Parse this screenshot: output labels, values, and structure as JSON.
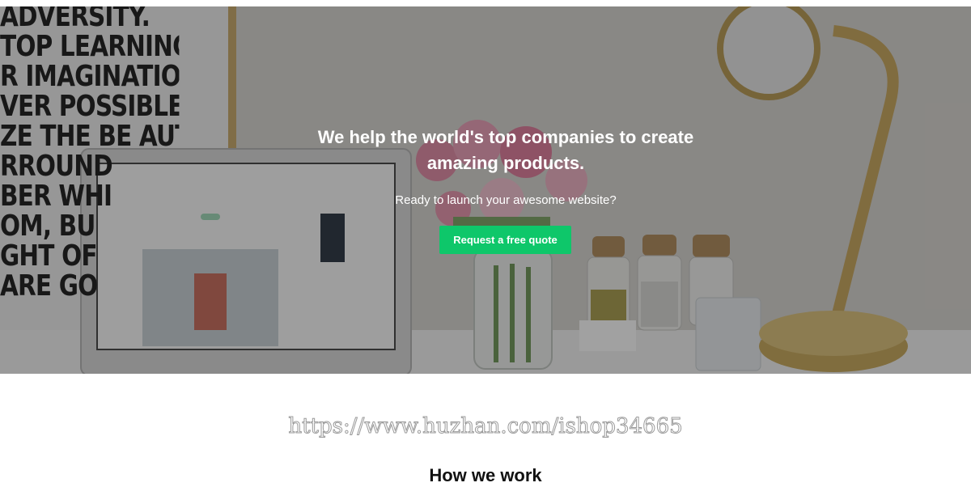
{
  "hero": {
    "poster_lines": [
      "ADVERSITY.",
      "TOP LEARNING.",
      "R IMAGINATION",
      "VER POSSIBLE.",
      "ZE THE BE AUTY",
      "RROUND",
      "BER WHI",
      "OM, BU",
      "GHT OF",
      "ARE GO"
    ],
    "title": "We help the world's top companies to create amazing products.",
    "subtitle": "Ready to launch your awesome website?",
    "cta_label": "Request a free quote",
    "colors": {
      "cta": "#0ec76a",
      "overlay": "#141414"
    }
  },
  "watermark": "https://www.huzhan.com/ishop34665",
  "section": {
    "title": "How we work"
  }
}
